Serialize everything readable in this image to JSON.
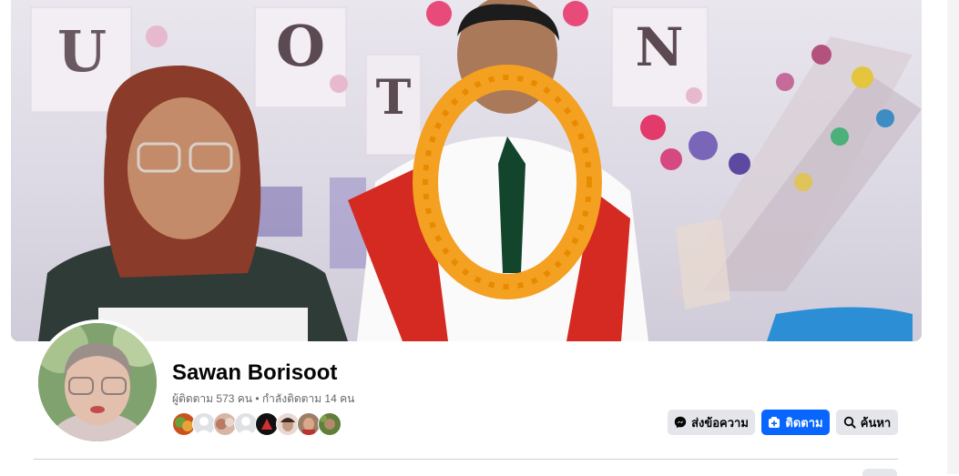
{
  "profile": {
    "name": "Sawan Borisoot",
    "stats": "ผู้ติดตาม 573 คน • กำลังติดตาม 14 คน"
  },
  "cover": {
    "letters": [
      "U",
      "O",
      "N",
      "T"
    ]
  },
  "actions": {
    "message_label": "ส่งข้อความ",
    "follow_label": "ติดตาม",
    "search_label": "ค้นหา"
  },
  "colors": {
    "accent": "#0866ff",
    "button_gray": "#e4e6eb",
    "text_secondary": "#65676b"
  }
}
